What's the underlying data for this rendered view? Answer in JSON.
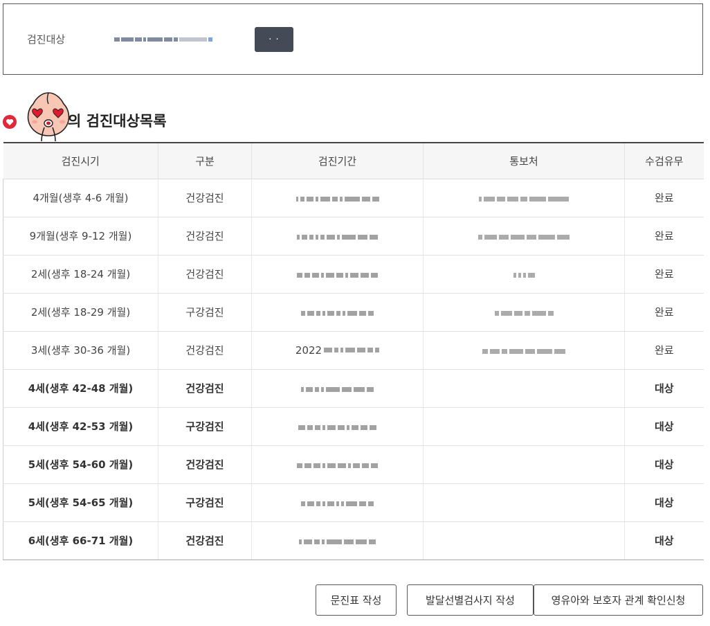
{
  "target": {
    "label": "검진대상"
  },
  "section": {
    "title": "의 검진대상목록"
  },
  "table": {
    "headers": [
      "검진시기",
      "구분",
      "검진기간",
      "통보처",
      "수검유무"
    ],
    "rows": [
      {
        "period": "4개월(생후 4-6 개월)",
        "type": "건강검진",
        "status": "완료",
        "bold": false
      },
      {
        "period": "9개월(생후 9-12 개월)",
        "type": "건강검진",
        "status": "완료",
        "bold": false
      },
      {
        "period": "2세(생후 18-24 개월)",
        "type": "건강검진",
        "status": "완료",
        "bold": false
      },
      {
        "period": "2세(생후 18-29 개월)",
        "type": "구강검진",
        "status": "완료",
        "bold": false
      },
      {
        "period": "3세(생후 30-36 개월)",
        "type": "건강검진",
        "status": "완료",
        "bold": false,
        "date_prefix": "2022"
      },
      {
        "period": "4세(생후 42-48 개월)",
        "type": "건강검진",
        "status": "대상",
        "bold": true
      },
      {
        "period": "4세(생후 42-53 개월)",
        "type": "구강검진",
        "status": "대상",
        "bold": true
      },
      {
        "period": "5세(생후 54-60 개월)",
        "type": "건강검진",
        "status": "대상",
        "bold": true
      },
      {
        "period": "5세(생후 54-65 개월)",
        "type": "구강검진",
        "status": "대상",
        "bold": true
      },
      {
        "period": "6세(생후 66-71 개월)",
        "type": "건강검진",
        "status": "대상",
        "bold": true
      }
    ]
  },
  "buttons": {
    "questionnaire": "문진표 작성",
    "development": "발달선별검사지 작성",
    "relation": "영유아와 보호자 관계 확인신청"
  },
  "colors": {
    "status_target": "#cc1a2b",
    "button_dark": "#454a57"
  }
}
